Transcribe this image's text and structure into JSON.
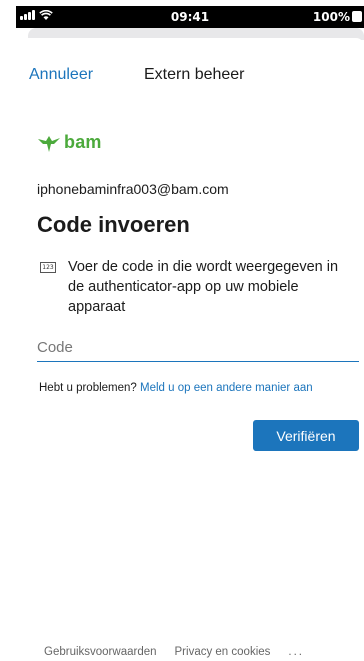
{
  "status_bar": {
    "time": "09:41",
    "battery": "100%"
  },
  "nav": {
    "cancel_label": "Annuleer",
    "title": "Extern beheer"
  },
  "brand": {
    "logo_text": "bam",
    "color": "#4caa3c"
  },
  "account": {
    "email": "iphonebaminfra003@bam.com"
  },
  "main": {
    "heading": "Code invoeren",
    "instruction_icon": "123",
    "instruction": "Voer de code in die wordt weergegeven in de authenticator-app op uw mobiele apparaat",
    "code_placeholder": "Code",
    "trouble_text": "Hebt u problemen?",
    "trouble_link": "Meld u op een andere manier aan",
    "verify_label": "Verifiëren"
  },
  "footer": {
    "terms": "Gebruiksvoorwaarden",
    "privacy": "Privacy en cookies",
    "more": "..."
  },
  "colors": {
    "accent": "#1c75bc",
    "text": "#1b1b1b"
  }
}
